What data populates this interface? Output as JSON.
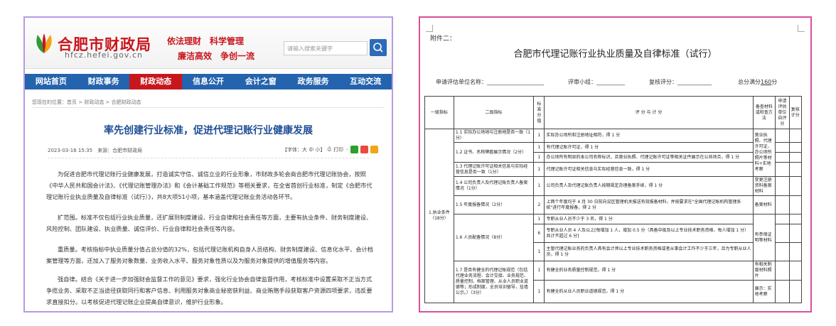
{
  "left": {
    "site_name": "合肥市财政局",
    "site_domain": "hfcz.hefei.gov.cn",
    "slogan_line1": "依法理财　科学管理",
    "slogan_line2": "廉洁高效　争创一流",
    "search_placeholder": "请输入搜索关键字",
    "nav": [
      "网站首页",
      "财政事务",
      "财政动态",
      "信息公开",
      "会计之窗",
      "政务服务",
      "互动交流"
    ],
    "nav_active_index": 2,
    "breadcrumb": "您现在的位置：首页 > 财政动态 > 合肥财政动态",
    "title": "率先创建行业标准，促进代理记账行业健康发展",
    "meta": "2023-03-16 15:35　来源：合肥市财政局",
    "font_size_label": "【字体：大 中 小】",
    "print_label": "打印",
    "paragraphs": [
      "为促进合肥市代理记账行业健康发展，打造诚实守信、诚信立业的行业形象，市财政多轮会商合肥市代理记账协会，按照《中华人民共和国会计法》、《代理记账管理办法》和《会计基础工作规范》等相关要求，在全省首创行业标准，制定《合肥市代理记账行业执业质量及自律标准（试行）》，共8大项51小项，基本涵盖代理记账业务活动各环节。",
      "扩范围。标准不仅包括行业执业质量，还扩展到制度建设、行业自律和社会责任等方面，主要有执业条件、财务制度建设、风险控制、团队建设、执业质量、诚信评价、行业自律和社会责任等内容。",
      "重质量。考核指标中执业质量分值占总分值的32%，包括代理记账机构自身人员结构、财务制度建设、信息化水平、会计档案管理等方面，还加入了服务对象数量、业务收入水平、服务对象性质以及为服务对象提供的增值服务等内容。",
      "强自律。结合《关于进一步加强财会监督工作的意见》要求，强化行业协会自律监督作用，考核标准中设置采取不正当方式争揽业务、采取不正当途径获取同行和客户信息、利用服务对象商业秘密获利益、商业贿赂手段获取客户资源四项要求，违反要求直接扣分。以考核促进代理记账企业提高自律意识，维护行业形象。"
    ],
    "colors": {
      "brand_red": "#c8161d",
      "nav_blue": "#2463ad",
      "title_blue": "#1f4e96"
    }
  },
  "right": {
    "attachment": "附件二：",
    "title": "合肥市代理记账行业执业质量及自律标准（试行）",
    "fields": {
      "org": "申请评估单位名称：____________________",
      "reviewer": "评审小组：__________",
      "recheck": "复核评分：____________",
      "total_prefix": "总分满分",
      "total_value": "160",
      "total_suffix": "分"
    },
    "headers": [
      "一级指标",
      "二级指标",
      "标准分值",
      "评 分 与 计 分",
      "备查材料或检查方法",
      "申请评估单位自评分",
      "复核计分"
    ],
    "level1": "1.执业条件\n（18分）",
    "rows": [
      {
        "l2": "1.1 实际办公场地与注册地是否一致（1分）",
        "score": "1",
        "rule": "实际办公场所和注册地址相符，得 1 分"
      },
      {
        "l2": "1.2 证书、名称牌匾展示情况（2分）",
        "score": "1",
        "rule": "有代理记账许可证，得 1 分"
      },
      {
        "l2": "",
        "score": "1",
        "rule": "办公场所有明显的本公司名称标识，且营业执照、代理记账许可证等相关证件展示在公共场合，得 1 分"
      },
      {
        "l2": "1.3 代理记账许可证相关信息与实际经营信息是否一致（1分）",
        "score": "1",
        "rule": "代理记账许可证相关信息与实际经营信息一致，得 1 分"
      },
      {
        "l2": "1.4 公司负责人及代理记账负责人备案情况（1分）",
        "score": "1",
        "rule": "公司负责人及代理记账负责人按期规定办理备案手续，得 1 分"
      },
      {
        "l2": "1.5 年度报备情况（2分）",
        "score": "2",
        "rule": "上两个年度均于 4 月 30 日前向设区管理机关报送有效报备材料，并按要求在\"全国代理记账机构管理系统\"进行年度报备，得 2 分"
      },
      {
        "l2": "1.6 人员配备情况（8分）",
        "score": "1",
        "rule": "专职从业人员不少于 3 名，得 1 分"
      },
      {
        "l2": "",
        "score": "6",
        "rule": "专职从业人员 4 人及以上[每增加 1 人，增加 0.5 分（具备中级及以上专业技术职务资格，每人增加 1 分）共计不超过 6 分]"
      },
      {
        "l2": "",
        "score": "1",
        "rule": "主管代理记账业务的负责人具有会计师以上专业技术职务资格或者从事会计工作不少于三年，且为专职从业人员，得 1 分"
      },
      {
        "l2": "1.7 是否有健全的代理记账规范（包括代理业务流程、会计交接、业务规范、质量控制、档案管理、从业人员职业道德等；形成制度，全员培训留导，挂墙公示。）（3分）",
        "score": "1",
        "rule": "有健全的业务质量控制规范，得 1 分"
      },
      {
        "l2": "",
        "score": "1",
        "rule": "有健全的从业人员职业道德规范，得 1 分"
      }
    ],
    "methods": {
      "m1": "营业执照、代理许可证、办公场所照片等材料+实地考察",
      "m2": "变更注册资料备案材料",
      "m3": "备案材料",
      "m4": "有参保证明等材料",
      "m5": "有相关制度材料照片",
      "m6": "展示：实地考察"
    },
    "colors": {
      "border_pink": "#d94f9b"
    }
  }
}
